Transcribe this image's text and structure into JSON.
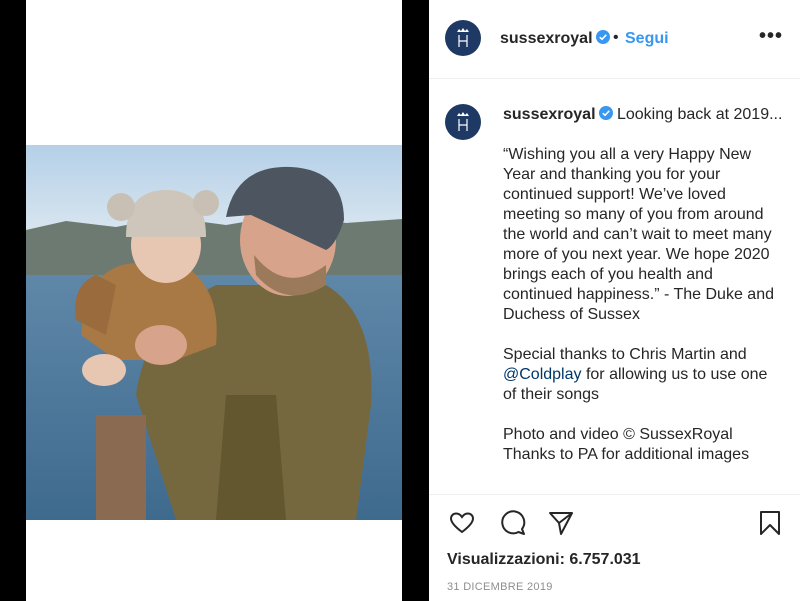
{
  "post": {
    "username": "sussexroyal",
    "follow_label": "Segui",
    "dot": "•",
    "more_label": "•••"
  },
  "caption": {
    "username": "sussexroyal",
    "intro": "Looking back at 2019...",
    "paragraph1": "“Wishing you all a very Happy New Year and thanking you for your continued support! We’ve loved meeting so many of you from around the world and can’t wait to meet many more of you next year. We hope 2020 brings each of you health and continued happiness.” - The Duke and Duchess of Sussex",
    "paragraph2_before": "Special thanks to Chris Martin and",
    "paragraph2_mention": "@Coldplay",
    "paragraph2_after": "for allowing us to use one of their songs",
    "paragraph3_line1": "Photo and video © SussexRoyal",
    "paragraph3_line2": "Thanks to PA for additional images"
  },
  "stats": {
    "views": "Visualizzazioni: 6.757.031",
    "date": "31 DICEMBRE 2019"
  },
  "colors": {
    "accent": "#3897f0",
    "avatar_bg": "#1e3a64",
    "mention": "#00376b"
  },
  "icons": [
    "like-icon",
    "comment-icon",
    "share-icon",
    "save-icon",
    "verified-icon",
    "monogram-icon"
  ]
}
